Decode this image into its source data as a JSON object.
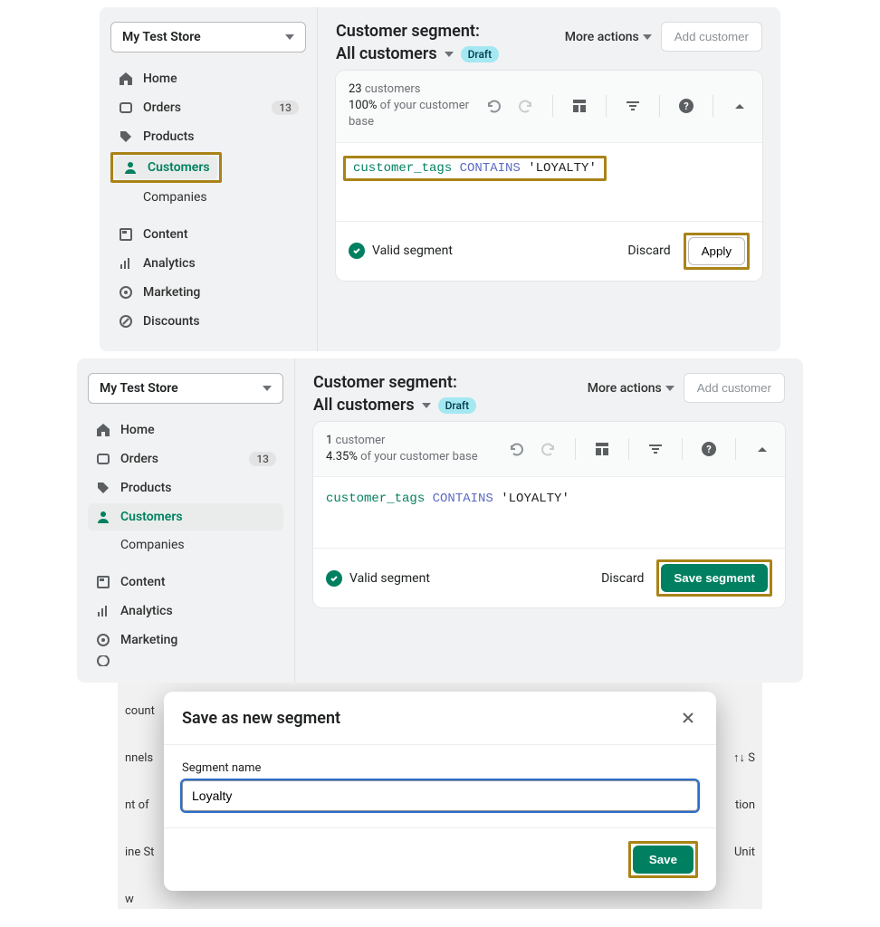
{
  "panel1": {
    "store_name": "My Test Store",
    "nav": {
      "home": "Home",
      "orders": "Orders",
      "orders_badge": "13",
      "products": "Products",
      "customers": "Customers",
      "companies": "Companies",
      "content": "Content",
      "analytics": "Analytics",
      "marketing": "Marketing",
      "discounts": "Discounts"
    },
    "header": {
      "title": "Customer segment:",
      "subtitle": "All customers",
      "draft": "Draft",
      "more_actions": "More actions",
      "add_customer": "Add customer"
    },
    "stats": {
      "count": "23",
      "count_label": " customers",
      "pct": "100%",
      "pct_label": " of your customer base"
    },
    "code": {
      "field": "customer_tags",
      "op": " CONTAINS ",
      "str": "'LOYALTY'"
    },
    "footer": {
      "valid": "Valid segment",
      "discard": "Discard",
      "apply": "Apply"
    }
  },
  "panel2": {
    "store_name": "My Test Store",
    "nav": {
      "home": "Home",
      "orders": "Orders",
      "orders_badge": "13",
      "products": "Products",
      "customers": "Customers",
      "companies": "Companies",
      "content": "Content",
      "analytics": "Analytics",
      "marketing": "Marketing"
    },
    "header": {
      "title": "Customer segment:",
      "subtitle": "All customers",
      "draft": "Draft",
      "more_actions": "More actions",
      "add_customer": "Add customer"
    },
    "stats": {
      "count": "1",
      "count_label": " customer",
      "pct": "4.35%",
      "pct_label": " of your customer base"
    },
    "code": {
      "field": "customer_tags",
      "op": " CONTAINS ",
      "str": "'LOYALTY'"
    },
    "footer": {
      "valid": "Valid segment",
      "discard": "Discard",
      "save": "Save segment"
    }
  },
  "modal": {
    "title": "Save as new segment",
    "label": "Segment name",
    "value": "Loyalty",
    "save": "Save",
    "bg_lines": [
      "count",
      "nnels",
      "nt of",
      "ine St",
      " ",
      "w"
    ],
    "bg_right": [
      " ",
      "↑↓ S",
      "tion",
      "Unit"
    ]
  }
}
